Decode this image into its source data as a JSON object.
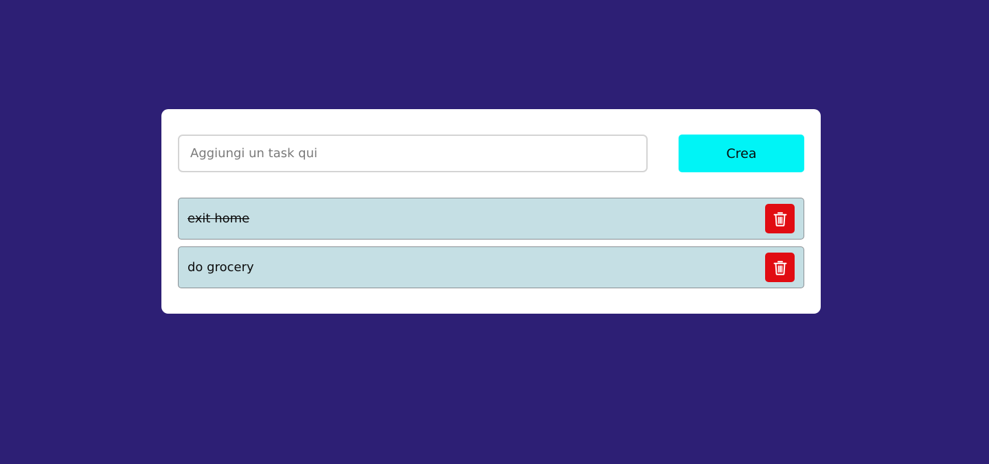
{
  "form": {
    "input_placeholder": "Aggiungi un task qui",
    "input_value": "",
    "create_label": "Crea"
  },
  "tasks": [
    {
      "text": "exit home",
      "completed": true,
      "delete_icon": "trash-icon"
    },
    {
      "text": "do grocery",
      "completed": false,
      "delete_icon": "trash-icon"
    }
  ],
  "colors": {
    "background": "#2d1f75",
    "card": "#ffffff",
    "accent_button": "#00f4f6",
    "task_background": "#c5dfe4",
    "delete_button": "#e10c12"
  }
}
